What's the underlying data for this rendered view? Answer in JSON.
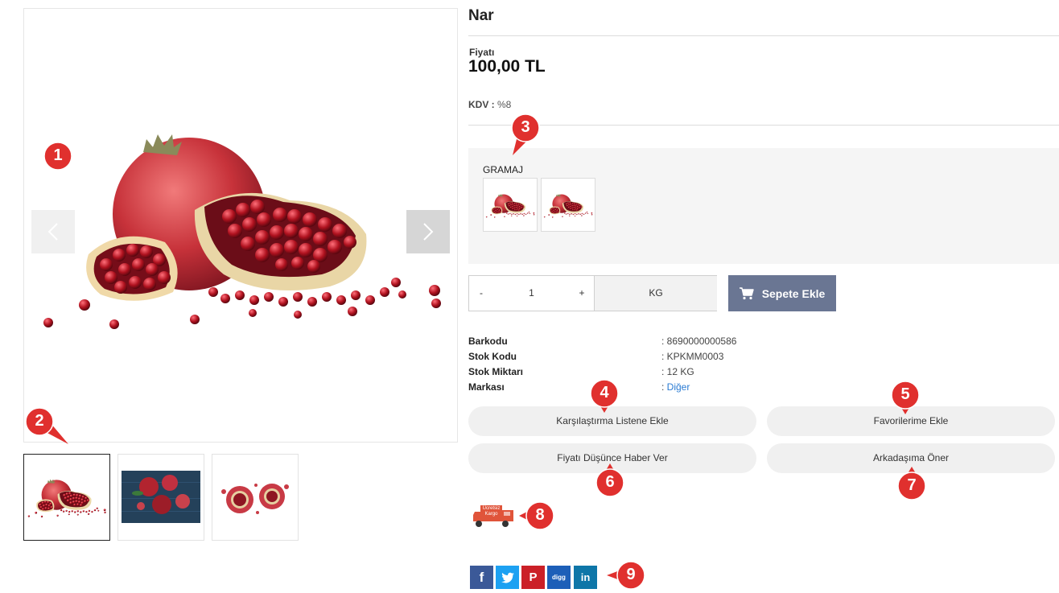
{
  "product": {
    "title": "Nar",
    "price_label": "Fiyatı",
    "price": "100,00 TL",
    "kdv_label": "KDV",
    "kdv_value": "%8"
  },
  "gallery": {
    "prev_icon": "chevron-left-icon",
    "next_icon": "chevron-right-icon",
    "thumbnails": [
      "pomegranate-white-background",
      "pomegranates-on-blue-wood",
      "pomegranate-splash"
    ]
  },
  "variant": {
    "label": "GRAMAJ",
    "options": [
      "pomegranate-option-1",
      "pomegranate-option-2"
    ]
  },
  "quantity": {
    "minus": "-",
    "value": "1",
    "plus": "+",
    "unit": "KG"
  },
  "cart": {
    "label": "Sepete Ekle",
    "icon": "cart-icon",
    "color": "#6a7693"
  },
  "specs": [
    {
      "label": "Barkodu",
      "value": ": 8690000000586"
    },
    {
      "label": "Stok Kodu",
      "value": ": KPKMM0003"
    },
    {
      "label": "Stok Miktarı",
      "value": ": 12 KG"
    },
    {
      "label": "Markası",
      "value_prefix": ": ",
      "value": "Diğer"
    }
  ],
  "actions": {
    "compare": "Karşılaştırma Listene Ekle",
    "favorites": "Favorilerime Ekle",
    "price_alert": "Fiyatı Düşünce Haber Ver",
    "recommend": "Arkadaşıma Öner"
  },
  "cargo": {
    "line1": "Ücretsiz",
    "line2": "Kargo",
    "icon": "truck-icon",
    "color": "#e0543a"
  },
  "share": [
    {
      "name": "facebook",
      "glyph": "f",
      "color": "#3b5998"
    },
    {
      "name": "twitter",
      "glyph": "t",
      "color": "#1da1f2"
    },
    {
      "name": "pinterest",
      "glyph": "P",
      "color": "#cb2027"
    },
    {
      "name": "digg",
      "glyph": "digg",
      "color": "#1d5fb8"
    },
    {
      "name": "linkedin",
      "glyph": "in",
      "color": "#0e76a8"
    }
  ],
  "markers": [
    "1",
    "2",
    "3",
    "4",
    "5",
    "6",
    "7",
    "8",
    "9"
  ],
  "marker_color": "#e0302e"
}
